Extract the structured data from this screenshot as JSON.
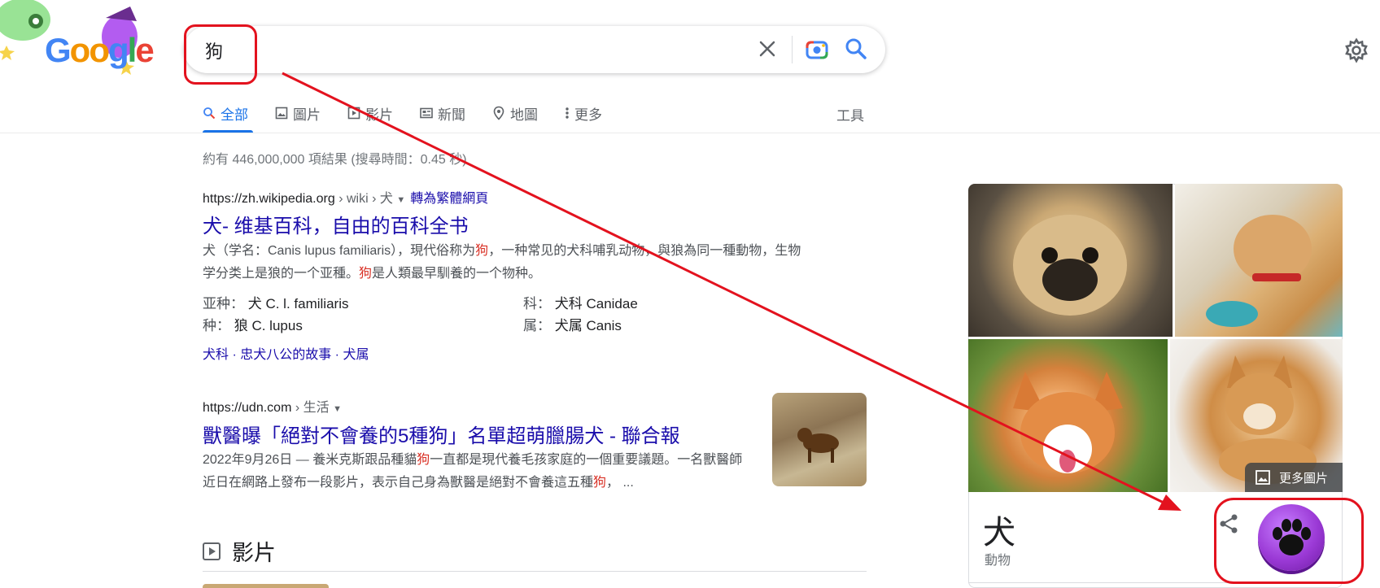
{
  "logo": {
    "text": "Google",
    "icon": "halloween-doodle-logo"
  },
  "search": {
    "query": "狗",
    "clear_icon": "close-icon",
    "lens_icon": "camera-lens-icon",
    "search_icon": "search-icon"
  },
  "settings_icon": "gear-icon",
  "tabs": [
    {
      "label": "全部",
      "icon": "search-icon",
      "active": true
    },
    {
      "label": "圖片",
      "icon": "image-icon"
    },
    {
      "label": "影片",
      "icon": "video-icon"
    },
    {
      "label": "新聞",
      "icon": "news-icon"
    },
    {
      "label": "地圖",
      "icon": "map-pin-icon"
    },
    {
      "label": "更多",
      "icon": "more-vert-icon"
    }
  ],
  "tools_label": "工具",
  "stats": "約有 446,000,000 項結果 (搜尋時間：0.45 秒)",
  "result1": {
    "domain": "https://zh.wikipedia.org",
    "crumb": " › wiki › 犬 ",
    "translate": "轉為繁體網頁",
    "title": "犬- 维基百科，自由的百科全书",
    "snippet_a": "犬（学名：Canis lupus familiaris），現代俗称为",
    "snippet_hl1": "狗",
    "snippet_b": "，一种常见的犬科哺乳动物，與狼為同一種動物，生物学分类上是狼的一个亚種。",
    "snippet_hl2": "狗",
    "snippet_c": "是人類最早馴養的一个物种。",
    "facts": [
      {
        "k": "亚种：",
        "v": "犬 C. l. familiaris"
      },
      {
        "k": "科：",
        "v": "犬科 Canidae"
      },
      {
        "k": "种：",
        "v": "狼 C. lupus"
      },
      {
        "k": "属：",
        "v": "犬属 Canis"
      }
    ],
    "sitelinks": "犬科 · 忠犬八公的故事 · 犬属"
  },
  "result2": {
    "domain": "https://udn.com",
    "crumb": " › 生活 ",
    "title": "獸醫曝「絕對不會養的5種狗」名單超萌臘腸犬 - 聯合報",
    "date": "2022年9月26日 — ",
    "snippet_a": "養米克斯跟品種貓",
    "snippet_hl1": "狗",
    "snippet_b": "一直都是現代養毛孩家庭的一個重要議題。一名獸醫師近日在網路上發布一段影片，表示自己身為獸醫是絕對不會養這五種",
    "snippet_hl2": "狗",
    "snippet_c": "， ..."
  },
  "videos_heading": "影片",
  "knowledge_panel": {
    "more_images": "更多圖片",
    "title": "犬",
    "subtitle": "動物",
    "share_icon": "share-icon",
    "paw_icon": "paw-icon"
  },
  "colors": {
    "link": "#1a0dab",
    "accent": "#1a73e8",
    "annotation": "#e3121e",
    "paw": "#9b3ad6"
  }
}
